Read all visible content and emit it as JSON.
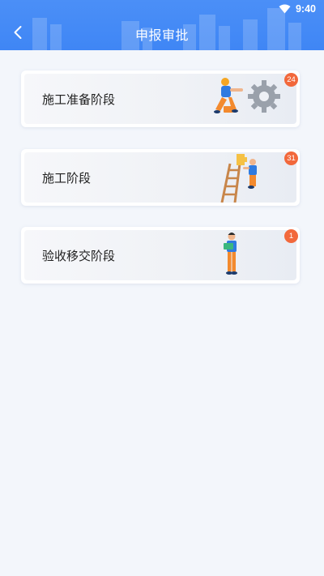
{
  "status_bar": {
    "time": "9:40",
    "wifi_icon": "wifi-icon"
  },
  "header": {
    "title": "申报审批",
    "back_icon": "chevron-left-icon"
  },
  "colors": {
    "header_blue": "#4b8ff7",
    "badge_orange": "#f2683b",
    "page_bg": "#f3f6fb"
  },
  "stages": [
    {
      "label": "施工准备阶段",
      "count": "24",
      "illustration": "worker-gear-icon"
    },
    {
      "label": "施工阶段",
      "count": "31",
      "illustration": "worker-ladder-icon"
    },
    {
      "label": "验收移交阶段",
      "count": "1",
      "illustration": "worker-reading-icon"
    }
  ]
}
